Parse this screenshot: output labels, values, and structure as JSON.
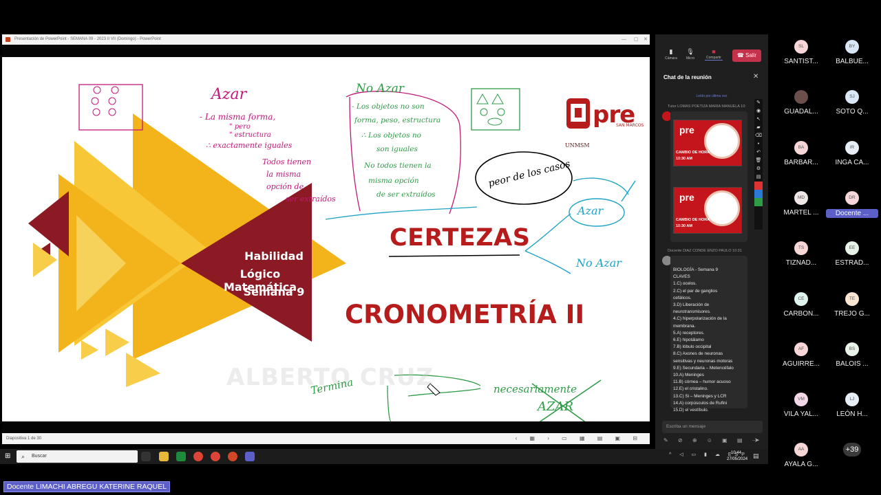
{
  "ppt": {
    "title": "Presentación de PowerPoint  -  SEMANA 09 - 2023 II VII (Domingo) - PowerPoint",
    "status": "Diapositiva 1 de 30",
    "slide": {
      "subject_line1": "Habilidad",
      "subject_line2": "Lógico Matemática",
      "subject_line3": "Semana 9",
      "title_certezas": "CERTEZAS",
      "title_crono": "CRONOMETRÍA II",
      "watermark": "ALBERTO CRUZ",
      "logo_text": "pre",
      "logo_sub": "SAN MARCOS",
      "logo_unmsm": "UNMSM",
      "colors": {
        "dark_red": "#8b1a24",
        "gold": "#f3b31b",
        "light_gold": "#f7cd49",
        "title_red": "#b71c1c"
      }
    },
    "ink": {
      "azar": "Azar",
      "azar_lines": [
        "- La misma forma,",
        "\" pero",
        "\" estructura",
        "∴ exactamente iguales"
      ],
      "todos_lines": [
        "Todos tienen",
        "la misma",
        "opción de",
        "ser extraídos"
      ],
      "noazar": "No Azar",
      "noazar_lines": [
        "- Los objetos no son",
        "forma, peso, estructura",
        "∴ Los objetos no",
        "son iguales",
        "No todos tienen la",
        "misma opción",
        "de ser extraídos"
      ],
      "peor": "peor de los casos",
      "branch_azar": "Azar",
      "branch_noazar": "No Azar",
      "bottom_left": "Termina",
      "bottom_right": "necesariamente",
      "crossed": "AZAR"
    }
  },
  "teams": {
    "camera": "Cámara",
    "mic": "Micro",
    "share": "Compartir",
    "leave": "Salir",
    "chat_title": "Chat de la reunión",
    "read_label": "Leído por última vez",
    "msg1_author": "Tutor LOMAS POETIZA MARIA MANUELA  10:",
    "img_pre": "pre",
    "img_caption1": "CAMBIO DE HORA",
    "img_caption2": "10:30 AM",
    "msg2_author": "Docente DIAZ CONDE ENZO PAULO  10:31",
    "claves": [
      "BIOLOGÍA - Semana 9",
      "CLAVES",
      "1.C) ocelos.",
      "2.C) el par de ganglios",
      "cefálicos.",
      "3.D) Liberación de",
      "neurotransmisores.",
      "4.C) hiperpolarización de la",
      "membrana.",
      "5.A) receptores.",
      "6.E) hipotálamo",
      "7.B) lóbulo occipital",
      "8.C) Axones de neuronas",
      "sensitivas y neuronas motoras",
      "9.E) Secundaria – Metencéfalo",
      "10.A) Meninges",
      "11.B) córnea – humor acuoso",
      "12.E) el cristalino.",
      "13.C) Si – Meninges y LCR",
      "14.A) corpúsculos de Rufini",
      "15.D) el vestíbulo."
    ],
    "compose_placeholder": "Escriba un mensaje"
  },
  "participants": [
    {
      "initials": "SL",
      "name": "SANTIST...",
      "color": "#f6d6d6"
    },
    {
      "initials": "BY",
      "name": "BALBUE...",
      "color": "#d8e6f6"
    },
    {
      "initials": "",
      "name": "GUADAL...",
      "color": "#6b4f4a"
    },
    {
      "initials": "SJ",
      "name": "SOTO Q...",
      "color": "#d8e6f6"
    },
    {
      "initials": "BA",
      "name": "BARBAR...",
      "color": "#f6d6d6"
    },
    {
      "initials": "IR",
      "name": "INGA CA...",
      "color": "#e6eef6"
    },
    {
      "initials": "MD",
      "name": "MARTEL ...",
      "color": "#efe6e6"
    },
    {
      "initials": "DR",
      "name": "Docente ...",
      "color": "#f6d6d6"
    },
    {
      "initials": "TS",
      "name": "TIZNAD...",
      "color": "#f6d6d6"
    },
    {
      "initials": "EE",
      "name": "ESTRAD...",
      "color": "#e6f3e6"
    },
    {
      "initials": "CE",
      "name": "CARBON...",
      "color": "#dff3ee"
    },
    {
      "initials": "TE",
      "name": "TREJO G...",
      "color": "#f9e6d2"
    },
    {
      "initials": "AF",
      "name": "AGUIRRE...",
      "color": "#f6d6d6"
    },
    {
      "initials": "BS",
      "name": "BALOIS ...",
      "color": "#e6f3e6"
    },
    {
      "initials": "VM",
      "name": "VILA YAL...",
      "color": "#f3d8e8"
    },
    {
      "initials": "LJ",
      "name": "LEÓN H...",
      "color": "#e6eef6"
    },
    {
      "initials": "AA",
      "name": "AYALA G...",
      "color": "#f6d6d6"
    },
    {
      "initials": "+39",
      "name": "",
      "color": "#3a3a3a"
    }
  ],
  "taskbar": {
    "search_placeholder": "Buscar",
    "lang": "ESP",
    "time": "10:44",
    "date": "27/05/2024"
  },
  "caption": "Docente LIMACHI ABREGU KATERINE RAQUEL"
}
